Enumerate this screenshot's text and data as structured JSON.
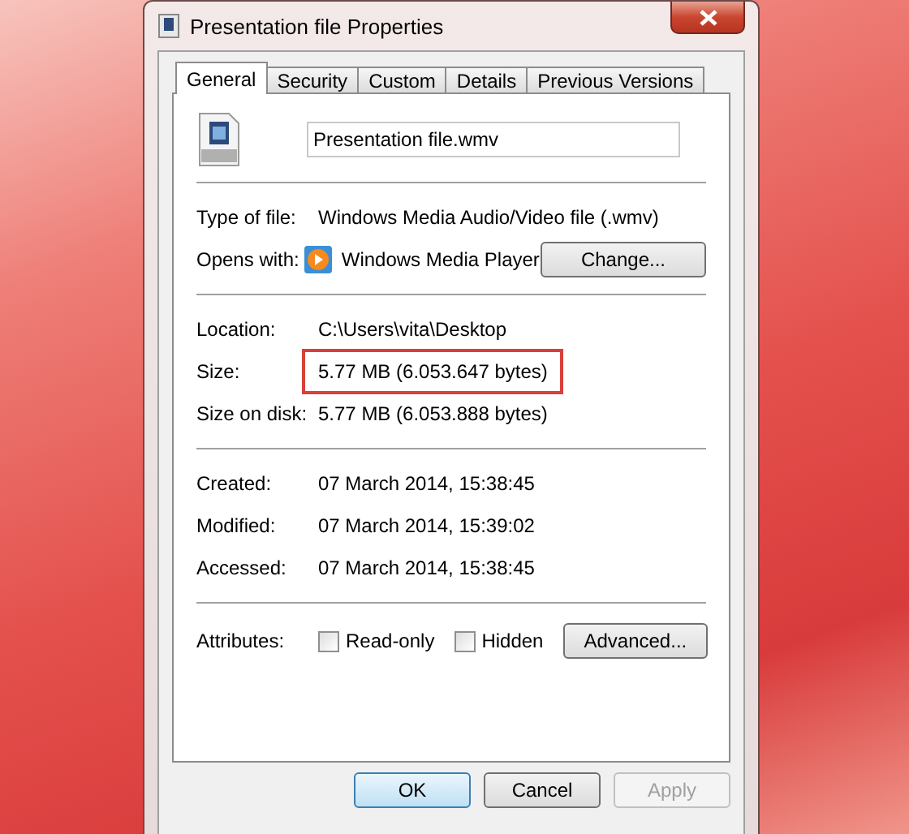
{
  "window": {
    "title": "Presentation file Properties"
  },
  "tabs": [
    {
      "label": "General",
      "selected": true
    },
    {
      "label": "Security",
      "selected": false
    },
    {
      "label": "Custom",
      "selected": false
    },
    {
      "label": "Details",
      "selected": false
    },
    {
      "label": "Previous Versions",
      "selected": false
    }
  ],
  "file": {
    "name": "Presentation file.wmv"
  },
  "type_row": {
    "label": "Type of file:",
    "value": "Windows Media Audio/Video file (.wmv)"
  },
  "opens_with": {
    "label": "Opens with:",
    "app": "Windows Media Player",
    "button": "Change..."
  },
  "location_rows": [
    {
      "label": "Location:",
      "value": "C:\\Users\\vita\\Desktop",
      "highlighted": false
    },
    {
      "label": "Size:",
      "value": "5.77 MB (6.053.647 bytes)",
      "highlighted": true
    },
    {
      "label": "Size on disk:",
      "value": "5.77 MB (6.053.888 bytes)",
      "highlighted": false
    }
  ],
  "date_rows": [
    {
      "label": "Created:",
      "value": "07 March 2014, 15:38:45"
    },
    {
      "label": "Modified:",
      "value": "07 March 2014, 15:39:02"
    },
    {
      "label": "Accessed:",
      "value": "07 March 2014, 15:38:45"
    }
  ],
  "attributes": {
    "label": "Attributes:",
    "checkboxes": [
      {
        "label": "Read-only",
        "checked": false
      },
      {
        "label": "Hidden",
        "checked": false
      }
    ],
    "button": "Advanced..."
  },
  "buttons": [
    {
      "label": "OK",
      "default": true,
      "disabled": false
    },
    {
      "label": "Cancel",
      "default": false,
      "disabled": false
    },
    {
      "label": "Apply",
      "default": false,
      "disabled": true
    }
  ]
}
